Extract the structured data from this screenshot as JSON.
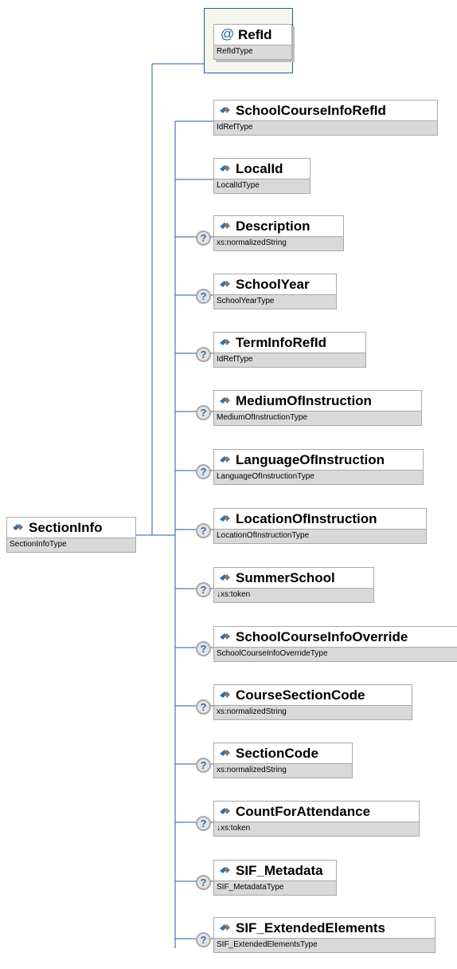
{
  "root": {
    "name": "SectionInfo",
    "type": "SectionInfoType"
  },
  "attribute": {
    "name": "RefId",
    "type": "RefIdType",
    "icon": "at-sign-icon"
  },
  "elements": [
    {
      "name": "SchoolCourseInfoRefId",
      "type": "IdRefType",
      "optional": false
    },
    {
      "name": "LocalId",
      "type": "LocalIdType",
      "optional": false
    },
    {
      "name": "Description",
      "type": "xs:normalizedString",
      "optional": true
    },
    {
      "name": "SchoolYear",
      "type": "SchoolYearType",
      "optional": true
    },
    {
      "name": "TermInfoRefId",
      "type": "IdRefType",
      "optional": true
    },
    {
      "name": "MediumOfInstruction",
      "type": "MediumOfInstructionType",
      "optional": true
    },
    {
      "name": "LanguageOfInstruction",
      "type": "LanguageOfInstructionType",
      "optional": true
    },
    {
      "name": "LocationOfInstruction",
      "type": "LocationOfInstructionType",
      "optional": true
    },
    {
      "name": "SummerSchool",
      "type": "↓xs:token",
      "optional": true
    },
    {
      "name": "SchoolCourseInfoOverride",
      "type": "SchoolCourseInfoOverrideType",
      "optional": true
    },
    {
      "name": "CourseSectionCode",
      "type": "xs:normalizedString",
      "optional": true
    },
    {
      "name": "SectionCode",
      "type": "xs:normalizedString",
      "optional": true
    },
    {
      "name": "CountForAttendance",
      "type": "↓xs:token",
      "optional": true
    },
    {
      "name": "SIF_Metadata",
      "type": "SIF_MetadataType",
      "optional": true
    },
    {
      "name": "SIF_ExtendedElements",
      "type": "SIF_ExtendedElementsType",
      "optional": true
    }
  ],
  "optional_marker": "?",
  "colors": {
    "connector": "#1f5f9f",
    "border": "#a9a9a9",
    "type_bg": "#d9d9d9",
    "icon": "#2f6fb0"
  }
}
